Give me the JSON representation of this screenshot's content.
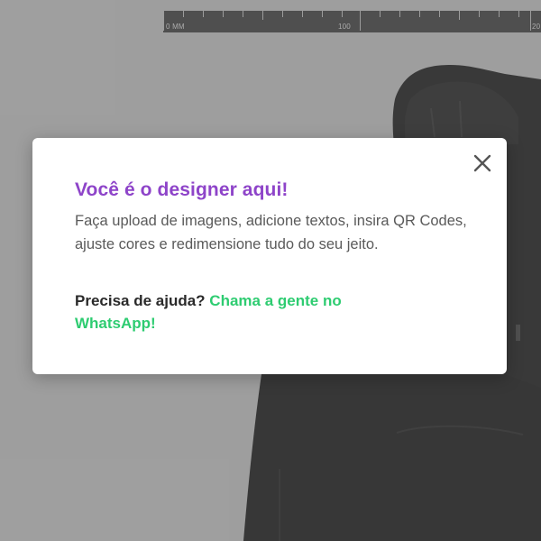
{
  "ruler": {
    "unit_label": "0 MM",
    "label_100": "100",
    "label_200": "20"
  },
  "modal": {
    "title": "Você é o designer aqui!",
    "body": "Faça upload de imagens, adicione textos, insira QR Codes, ajuste cores e redimensione tudo do seu jeito.",
    "help_prefix": "Precisa de ajuda? ",
    "help_link": "Chama a gente no WhatsApp!",
    "close_icon": "close-icon"
  },
  "colors": {
    "title": "#8e44c9",
    "link": "#2ecc71",
    "overlay": "#6e6e6e",
    "ruler_bg": "#3a3a3a",
    "garment": "#141414"
  }
}
